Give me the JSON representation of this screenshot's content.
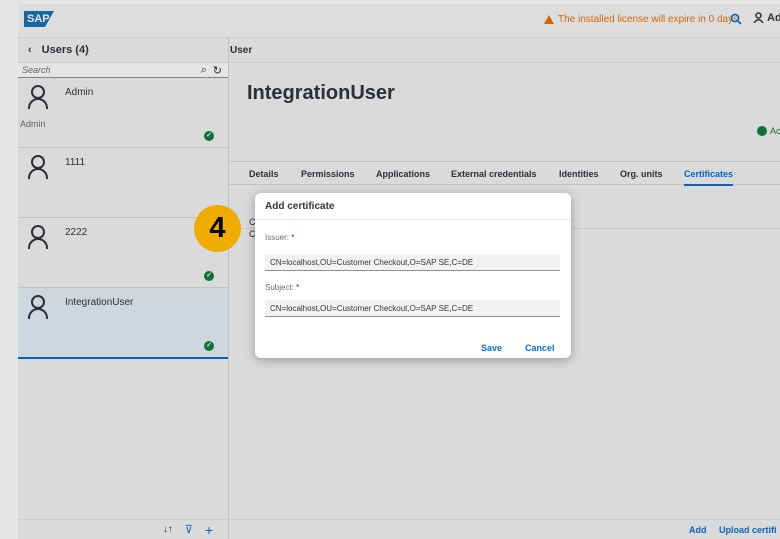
{
  "shell": {
    "logo": "SAP",
    "license_warning": "The installed license will expire in 0 days",
    "user_initials": "Ad"
  },
  "master": {
    "title": "Users (4)",
    "search_placeholder": "Search",
    "items": [
      {
        "name": "Admin",
        "sub": "Admin",
        "status": "active"
      },
      {
        "name": "1111",
        "sub": "",
        "status": ""
      },
      {
        "name": "2222",
        "sub": "",
        "status": "active"
      },
      {
        "name": "IntegrationUser",
        "sub": "",
        "status": "active",
        "selected": true
      }
    ]
  },
  "detail": {
    "header": "User",
    "title": "IntegrationUser",
    "status": "Acti",
    "tabs": [
      "Details",
      "Permissions",
      "Applications",
      "External credentials",
      "Identities",
      "Org. units",
      "Certificates"
    ],
    "active_tab": "Certificates",
    "behind_1": "C",
    "behind_2": "C",
    "footer_add": "Add",
    "footer_upload": "Upload certifi"
  },
  "dialog": {
    "title": "Add certificate",
    "issuer_label": "Issuer:",
    "issuer_value": "CN=localhost,OU=Customer Checkout,O=SAP SE,C=DE",
    "subject_label": "Subject:",
    "subject_value": "CN=localhost,OU=Customer Checkout,O=SAP SE,C=DE",
    "save": "Save",
    "cancel": "Cancel"
  },
  "step_badge": "4",
  "colors": {
    "accent": "#0a6ed1",
    "success": "#107e3e",
    "warning": "#e9730c",
    "badge": "#f0ab00"
  }
}
